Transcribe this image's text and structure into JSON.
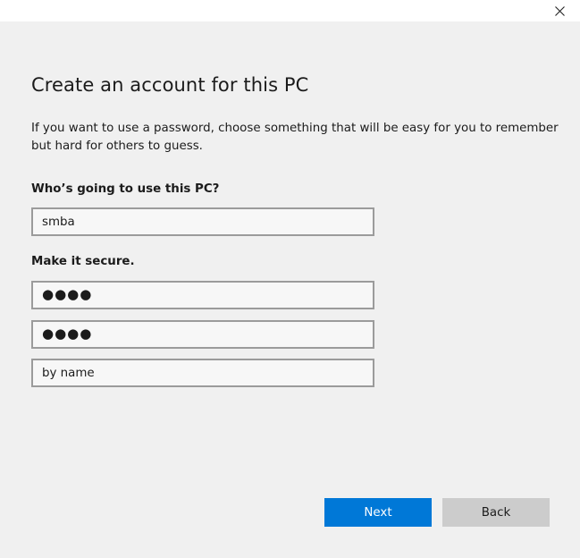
{
  "window": {
    "close_icon": "close-icon"
  },
  "page": {
    "title": "Create an account for this PC",
    "intro": "If you want to use a password, choose something that will be easy for you to remember but hard for others to guess."
  },
  "form": {
    "user_label": "Who’s going to use this PC?",
    "user_value": "smba",
    "secure_label": "Make it secure.",
    "password_value": "●●●●",
    "confirm_password_value": "●●●●",
    "hint_value": "by name"
  },
  "buttons": {
    "next": "Next",
    "back": "Back"
  },
  "colors": {
    "accent": "#0078d7",
    "secondary_button": "#cccccc",
    "background": "#f0f0f0"
  }
}
